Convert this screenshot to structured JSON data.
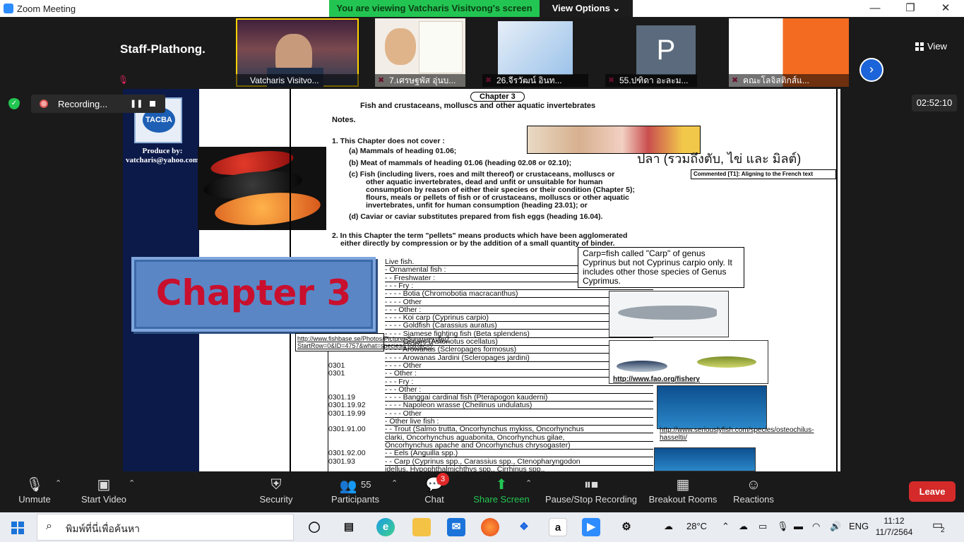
{
  "window": {
    "title": "Zoom Meeting",
    "viewing_banner": "You are viewing Vatcharis Visitvong's screen",
    "view_options": "View Options ⌄",
    "minimize": "—",
    "maximize": "❐",
    "close": "✕"
  },
  "gallery": {
    "staff_label": "Staff-Plathong.",
    "view_label": "View",
    "next_icon": "›",
    "tiles": [
      {
        "name": "Vatcharis Visitvo..."
      },
      {
        "name": "7.เศรษฐพัส อุ่นบ..."
      },
      {
        "name": "26.จีรวัฒน์ อินท..."
      },
      {
        "name": "55.ปฑิดา อะละม...",
        "avatar_letter": "P"
      },
      {
        "name": "คณะโลจิสติกส์แ..."
      }
    ]
  },
  "recording": {
    "label": "Recording...",
    "pause_icon": "❚❚",
    "timer": "02:52:10"
  },
  "slide": {
    "logo_text": "TACBA",
    "produce_by": "Produce by:",
    "email": "vatcharis@yahoo.com",
    "chapter_title": "Chapter 3",
    "doc": {
      "chapter_tag": "Chapter 3",
      "heading": "Fish and crustaceans, molluscs and other aquatic invertebrates",
      "notes": "Notes.",
      "lines": [
        "1. This Chapter does not cover :",
        "(a)  Mammals of heading 01.06;",
        "(b)  Meat of mammals of heading 01.06 (heading 02.08 or 02.10);",
        "(c)  Fish (including livers, roes and milt thereof) or crustaceans, molluscs or",
        "other aquatic invertebrates, dead and unfit or unsuitable for human",
        "consumption by reason of either their species or their condition (Chapter 5);",
        "flours, meals or pellets of fish or of crustaceans, molluscs or other aquatic",
        "invertebrates, unfit for human consumption (heading 23.01); or",
        "(d)  Caviar or caviar substitutes prepared from fish eggs (heading 16.04).",
        "2. In this Chapter the term \"pellets\" means products which have been agglomerated",
        "either directly by compression or by the addition of a small quantity of binder."
      ],
      "thai_note": "ปลา (รวมถึงตับ, ไข่ และ มิลต์)",
      "comment": "Commented [T1]: Aligning to the French text",
      "carp_note": "Carp=fish called \"Carp\" of genus Cyprinus but not Cyprinus carpio only. It includes other those species of Genus Cyprimus.",
      "table_rows": [
        {
          "code": "",
          "text": "Live fish."
        },
        {
          "code": "",
          "text": "- Ornamental fish :"
        },
        {
          "code": "",
          "text": "- - Freshwater :"
        },
        {
          "code": "",
          "text": "- - - Fry :"
        },
        {
          "code": "",
          "text": "- - - - Botia (Chromobotia macracanthus)"
        },
        {
          "code": "",
          "text": "- - - - Other"
        },
        {
          "code": "",
          "text": "- - - Other :"
        },
        {
          "code": "",
          "text": "- - - - Koi carp (Cyprinus carpio)"
        },
        {
          "code": "",
          "text": "- - - - Goldfish (Carassius auratus)"
        },
        {
          "code": "",
          "text": "- - - - Siamese fighting fish (Beta splendens)"
        },
        {
          "code": "",
          "text": "- - - - Oscars (Astonotus ocellatus)"
        },
        {
          "code": "",
          "text": "- - - - Arowanas (Scleropages formosus)"
        },
        {
          "code": "",
          "text": "- - - - Arowanas Jardini (Scleropages jardini)"
        },
        {
          "code": "0301",
          "text": "- - - - Other"
        },
        {
          "code": "0301",
          "text": "- - Other :"
        },
        {
          "code": "",
          "text": "- - - Fry :"
        },
        {
          "code": "",
          "text": "- - - Other :"
        },
        {
          "code": "0301.19",
          "text": "- - - - Banggai cardinal fish (Pterapogon kauderni)"
        },
        {
          "code": "0301.19.92",
          "text": "- - - - Napoleon wrasse (Cheilinus undulatus)"
        },
        {
          "code": "0301.19.99",
          "text": "- - - - Other"
        },
        {
          "code": "",
          "text": "- Other live fish :"
        },
        {
          "code": "0301.91.00",
          "text": "- - Trout (Salmo trutta, Oncorhynchus mykiss, Oncorhynchus"
        },
        {
          "code": "",
          "text": "clarki, Oncorhynchus aguabonita, Oncorhynchus gilae,"
        },
        {
          "code": "",
          "text": "Oncorhynchus apache and Oncorhynchus chrysogaster)"
        },
        {
          "code": "0301.92.00",
          "text": "- - Eels (Anguilla spp.)"
        },
        {
          "code": "0301.93",
          "text": "- - Carp (Cyprinus spp., Carassius spp., Ctenopharyngodon"
        },
        {
          "code": "",
          "text": "idellus, Hypophthalmichthys spp., Cirrhinus spp.,"
        }
      ],
      "fishbase_link": "http://www.fishbase.se/Photos/PicturesSummary.php?StartRow=0&ID=4757&what=species&TotRec=7",
      "fao_link": "http://www.fao.org/fishery",
      "seriously_link": "http://www.seriouslyfish.com/species/osteochilus-hasseltii/"
    }
  },
  "toolbar": {
    "unmute": "Unmute",
    "start_video": "Start Video",
    "security": "Security",
    "participants": "Participants",
    "participants_count": "55",
    "chat": "Chat",
    "chat_badge": "3",
    "share_screen": "Share Screen",
    "pause_stop": "Pause/Stop Recording",
    "breakout": "Breakout Rooms",
    "reactions": "Reactions",
    "leave": "Leave"
  },
  "taskbar": {
    "search_placeholder": "พิมพ์ที่นี่เพื่อค้นหา",
    "temperature": "28°C",
    "language": "ENG",
    "time": "11:12",
    "date": "11/7/2564",
    "notification_count": "2"
  },
  "colors": {
    "zoom_blue": "#2d8cff",
    "banner_green": "#23c552",
    "leave_red": "#d42a2a",
    "chapter_red": "#c8102e"
  }
}
